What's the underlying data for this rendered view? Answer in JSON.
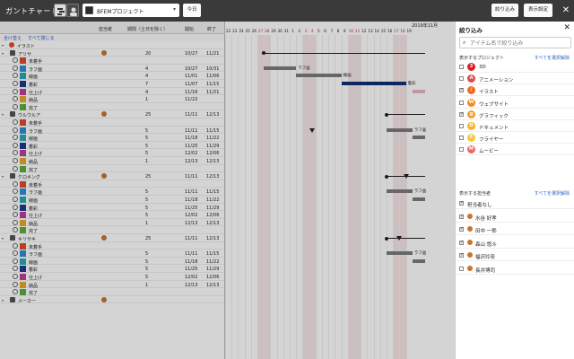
{
  "app_title": "ガントチャート",
  "project_select": {
    "value": "BFEMプロジェクト"
  },
  "toolbar": {
    "today": "今日",
    "filter": "絞り込み",
    "settings": "表示設定"
  },
  "columns": {
    "assignee": "担当者",
    "duration": "期間（土日を除く）",
    "start": "開始",
    "end": "終了"
  },
  "actions": {
    "expand_all": "全け替え",
    "collapse_all": "すべて閉じる"
  },
  "rows": [
    {
      "type": "category",
      "label": "イラスト",
      "badge_color": "#e24b2a"
    },
    {
      "type": "group",
      "label": "アリサ",
      "avatar": true,
      "duration": "20",
      "start": "10/27",
      "end": "11/21"
    },
    {
      "type": "task",
      "label": "未着手",
      "color": "#e24b2a",
      "duration": "",
      "start": "",
      "end": ""
    },
    {
      "type": "task",
      "label": "ラフ画",
      "color": "#2d8fd5",
      "duration": "4",
      "start": "10/27",
      "end": "10/31"
    },
    {
      "type": "task",
      "label": "線画",
      "color": "#2ba6b5",
      "duration": "4",
      "start": "11/01",
      "end": "11/06"
    },
    {
      "type": "task",
      "label": "着彩",
      "color": "#1f3b8c",
      "duration": "7",
      "start": "11/07",
      "end": "11/15"
    },
    {
      "type": "task",
      "label": "仕上げ",
      "color": "#c23b9d",
      "duration": "4",
      "start": "11/16",
      "end": "11/21"
    },
    {
      "type": "task",
      "label": "納品",
      "color": "#e9a82b",
      "duration": "1",
      "start": "11/22",
      "end": ""
    },
    {
      "type": "task",
      "label": "完了",
      "color": "#58b03c",
      "duration": "",
      "start": "",
      "end": ""
    },
    {
      "type": "group",
      "label": "ウルウルア",
      "avatar": true,
      "duration": "25",
      "start": "11/11",
      "end": "12/13"
    },
    {
      "type": "task",
      "label": "未着手",
      "color": "#e24b2a",
      "duration": "",
      "start": "",
      "end": ""
    },
    {
      "type": "task",
      "label": "ラフ画",
      "color": "#2d8fd5",
      "duration": "5",
      "start": "11/11",
      "end": "11/15"
    },
    {
      "type": "task",
      "label": "線画",
      "color": "#2ba6b5",
      "duration": "5",
      "start": "11/18",
      "end": "11/22"
    },
    {
      "type": "task",
      "label": "着彩",
      "color": "#1f3b8c",
      "duration": "5",
      "start": "11/25",
      "end": "11/29"
    },
    {
      "type": "task",
      "label": "仕上げ",
      "color": "#c23b9d",
      "duration": "5",
      "start": "12/02",
      "end": "12/06"
    },
    {
      "type": "task",
      "label": "納品",
      "color": "#e9a82b",
      "duration": "1",
      "start": "12/13",
      "end": "12/13"
    },
    {
      "type": "task",
      "label": "完了",
      "color": "#58b03c",
      "duration": "",
      "start": "",
      "end": ""
    },
    {
      "type": "group",
      "label": "ケロキング",
      "avatar": true,
      "duration": "25",
      "start": "11/11",
      "end": "12/13"
    },
    {
      "type": "task",
      "label": "未着手",
      "color": "#e24b2a",
      "duration": "",
      "start": "",
      "end": ""
    },
    {
      "type": "task",
      "label": "ラフ画",
      "color": "#2d8fd5",
      "duration": "5",
      "start": "11/11",
      "end": "11/15"
    },
    {
      "type": "task",
      "label": "線画",
      "color": "#2ba6b5",
      "duration": "5",
      "start": "11/18",
      "end": "11/22"
    },
    {
      "type": "task",
      "label": "着彩",
      "color": "#1f3b8c",
      "duration": "5",
      "start": "11/25",
      "end": "11/29"
    },
    {
      "type": "task",
      "label": "仕上げ",
      "color": "#c23b9d",
      "duration": "5",
      "start": "12/02",
      "end": "12/06"
    },
    {
      "type": "task",
      "label": "納品",
      "color": "#e9a82b",
      "duration": "1",
      "start": "12/13",
      "end": "12/13"
    },
    {
      "type": "task",
      "label": "完了",
      "color": "#58b03c",
      "duration": "",
      "start": "",
      "end": ""
    },
    {
      "type": "group",
      "label": "キリサキ",
      "avatar": true,
      "duration": "25",
      "start": "11/11",
      "end": "12/13"
    },
    {
      "type": "task",
      "label": "未着手",
      "color": "#e24b2a",
      "duration": "",
      "start": "",
      "end": ""
    },
    {
      "type": "task",
      "label": "ラフ画",
      "color": "#2d8fd5",
      "duration": "5",
      "start": "11/11",
      "end": "11/15"
    },
    {
      "type": "task",
      "label": "線画",
      "color": "#2ba6b5",
      "duration": "5",
      "start": "11/18",
      "end": "11/22"
    },
    {
      "type": "task",
      "label": "着彩",
      "color": "#1f3b8c",
      "duration": "5",
      "start": "11/25",
      "end": "11/29"
    },
    {
      "type": "task",
      "label": "仕上げ",
      "color": "#c23b9d",
      "duration": "5",
      "start": "12/02",
      "end": "12/06"
    },
    {
      "type": "task",
      "label": "納品",
      "color": "#e9a82b",
      "duration": "1",
      "start": "12/13",
      "end": "12/13"
    },
    {
      "type": "task",
      "label": "完了",
      "color": "#58b03c",
      "duration": "",
      "start": "",
      "end": ""
    },
    {
      "type": "group",
      "label": "メーカー",
      "avatar": true,
      "duration": "",
      "start": "",
      "end": ""
    }
  ],
  "timeline": {
    "month_label": "2019年11月",
    "days": [
      "22",
      "23",
      "24",
      "25",
      "26",
      "27",
      "28",
      "29",
      "30",
      "31",
      "1",
      "2",
      "3",
      "4",
      "5",
      "6",
      "7",
      "8",
      "9",
      "10",
      "11",
      "12",
      "13",
      "14",
      "15",
      "16",
      "17",
      "18",
      "19"
    ],
    "weekend_idx": [
      5,
      6,
      12,
      13,
      19,
      20,
      26,
      27
    ],
    "bars": [
      {
        "row": 3,
        "start": 6,
        "len": 5,
        "kind": "gray",
        "label": "ラフ画"
      },
      {
        "row": 4,
        "start": 11,
        "len": 7,
        "kind": "gray",
        "label": "線画"
      },
      {
        "row": 5,
        "start": 18,
        "len": 10,
        "kind": "blue",
        "label": "着彩"
      },
      {
        "row": 6,
        "start": 29,
        "len": 2,
        "kind": "pink",
        "label": ""
      },
      {
        "row": 11,
        "start": 25,
        "len": 4,
        "kind": "gray",
        "label": "ラフ画"
      },
      {
        "row": 12,
        "start": 29,
        "len": 2,
        "kind": "gray",
        "label": ""
      },
      {
        "row": 19,
        "start": 25,
        "len": 4,
        "kind": "gray",
        "label": "ラフ画"
      },
      {
        "row": 20,
        "start": 29,
        "len": 2,
        "kind": "gray",
        "label": ""
      },
      {
        "row": 27,
        "start": 25,
        "len": 4,
        "kind": "gray",
        "label": "ラフ画"
      },
      {
        "row": 28,
        "start": 29,
        "len": 2,
        "kind": "gray",
        "label": ""
      }
    ],
    "group_lines": [
      {
        "row": 1,
        "start": 6,
        "end": 31,
        "tri_at": null
      },
      {
        "row": 9,
        "start": 25,
        "end": 31,
        "tri_at": null
      },
      {
        "row": 17,
        "start": 25,
        "end": 31,
        "tri_at": 28
      },
      {
        "row": 25,
        "start": 25,
        "end": 31,
        "tri_at": 27
      }
    ],
    "standalone_tri": [
      {
        "row": 11,
        "at": 13
      }
    ]
  },
  "panel": {
    "title": "絞り込み",
    "search_placeholder": "アイテム名で絞り込み",
    "projects_header": "表示するプロジェクト",
    "projects_clear": "すべてを選択解除",
    "projects": [
      {
        "label": "3D",
        "badge": "3",
        "color": "#d81f26",
        "checked": false
      },
      {
        "label": "アニメーション",
        "badge": "A",
        "color": "#e24b4a",
        "checked": false
      },
      {
        "label": "イラスト",
        "badge": "/",
        "color": "#f06a20",
        "checked": true
      },
      {
        "label": "ウェブサイト",
        "badge": "W",
        "color": "#f28a1e",
        "checked": false
      },
      {
        "label": "グラフィック",
        "badge": "g",
        "color": "#f3a22a",
        "checked": true
      },
      {
        "label": "ドキュメント",
        "badge": "D",
        "color": "#f5b62e",
        "checked": false
      },
      {
        "label": "フライヤー",
        "badge": "F",
        "color": "#f7c93a",
        "checked": false
      },
      {
        "label": "ムービー",
        "badge": "M",
        "color": "#e66a6a",
        "checked": false
      }
    ],
    "users_header": "表示する担当者",
    "users_clear": "すべてを選択解除",
    "users": [
      {
        "label": "担当者なし",
        "checked": true,
        "avatar": false
      },
      {
        "label": "水谷 好孝",
        "checked": true,
        "avatar": true
      },
      {
        "label": "田中 一郎",
        "checked": true,
        "avatar": true
      },
      {
        "label": "森山 悠斗",
        "checked": true,
        "avatar": true
      },
      {
        "label": "福沢玲奈",
        "checked": true,
        "avatar": true
      },
      {
        "label": "長井博司",
        "checked": false,
        "avatar": true
      }
    ]
  }
}
